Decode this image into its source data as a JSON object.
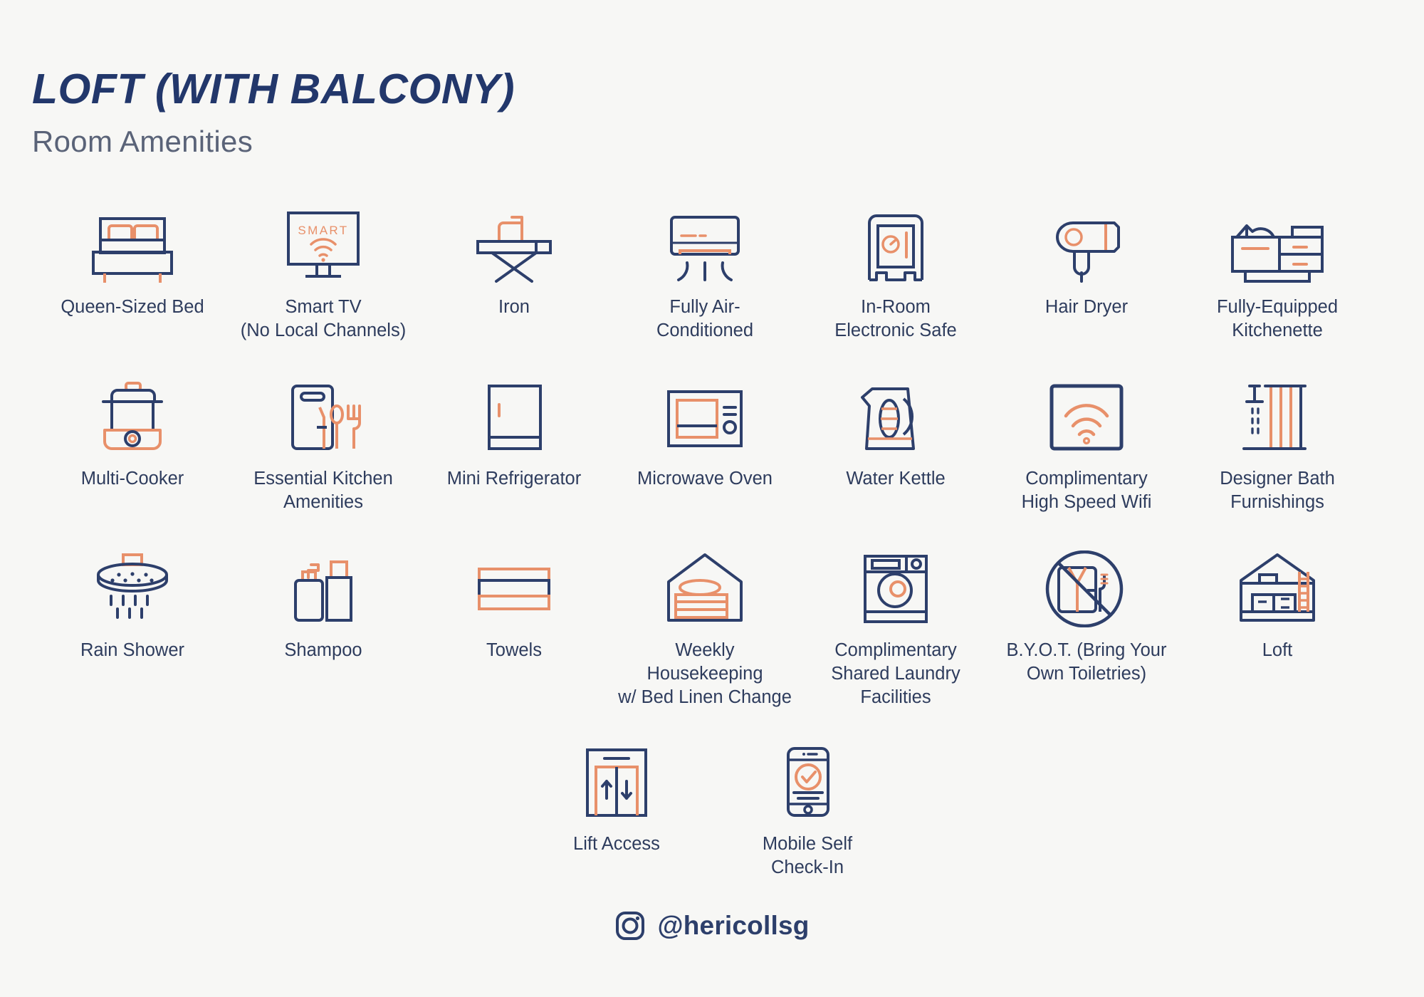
{
  "header": {
    "title": "LOFT (WITH BALCONY)",
    "subtitle": "Room Amenities"
  },
  "colors": {
    "background": "#f7f7f5",
    "navy": "#2d3f6b",
    "salmon": "#e8906a",
    "title_navy": "#22376b",
    "subtitle_gray": "#5a6378",
    "label_navy": "#2e3c5d"
  },
  "rows": [
    {
      "items": [
        {
          "icon": "bed-icon",
          "label": "Queen-Sized Bed"
        },
        {
          "icon": "smart-tv-icon",
          "label": "Smart TV\n(No Local Channels)"
        },
        {
          "icon": "iron-icon",
          "label": "Iron"
        },
        {
          "icon": "air-conditioner-icon",
          "label": "Fully Air-\nConditioned"
        },
        {
          "icon": "safe-icon",
          "label": "In-Room\nElectronic Safe"
        },
        {
          "icon": "hair-dryer-icon",
          "label": "Hair Dryer"
        },
        {
          "icon": "kitchenette-icon",
          "label": "Fully-Equipped\nKitchenette"
        }
      ]
    },
    {
      "items": [
        {
          "icon": "multi-cooker-icon",
          "label": "Multi-Cooker"
        },
        {
          "icon": "kitchen-utensils-icon",
          "label": "Essential Kitchen\nAmenities"
        },
        {
          "icon": "mini-refrigerator-icon",
          "label": "Mini Refrigerator"
        },
        {
          "icon": "microwave-icon",
          "label": "Microwave Oven"
        },
        {
          "icon": "kettle-icon",
          "label": "Water Kettle"
        },
        {
          "icon": "wifi-icon",
          "label": "Complimentary\nHigh Speed Wifi"
        },
        {
          "icon": "bath-furnishings-icon",
          "label": "Designer Bath\nFurnishings"
        }
      ]
    },
    {
      "items": [
        {
          "icon": "rain-shower-icon",
          "label": "Rain Shower"
        },
        {
          "icon": "shampoo-icon",
          "label": "Shampoo"
        },
        {
          "icon": "towels-icon",
          "label": "Towels"
        },
        {
          "icon": "housekeeping-icon",
          "label": "Weekly Housekeeping\nw/ Bed Linen Change"
        },
        {
          "icon": "laundry-icon",
          "label": "Complimentary\nShared Laundry\nFacilities"
        },
        {
          "icon": "no-toiletries-icon",
          "label": "B.Y.O.T. (Bring Your\nOwn Toiletries)"
        },
        {
          "icon": "loft-house-icon",
          "label": "Loft"
        }
      ]
    },
    {
      "items": [
        {
          "icon": "lift-icon",
          "label": "Lift Access"
        },
        {
          "icon": "mobile-checkin-icon",
          "label": "Mobile Self\nCheck-In"
        }
      ]
    }
  ],
  "footer": {
    "icon": "instagram-icon",
    "handle": "@hericollsg"
  }
}
